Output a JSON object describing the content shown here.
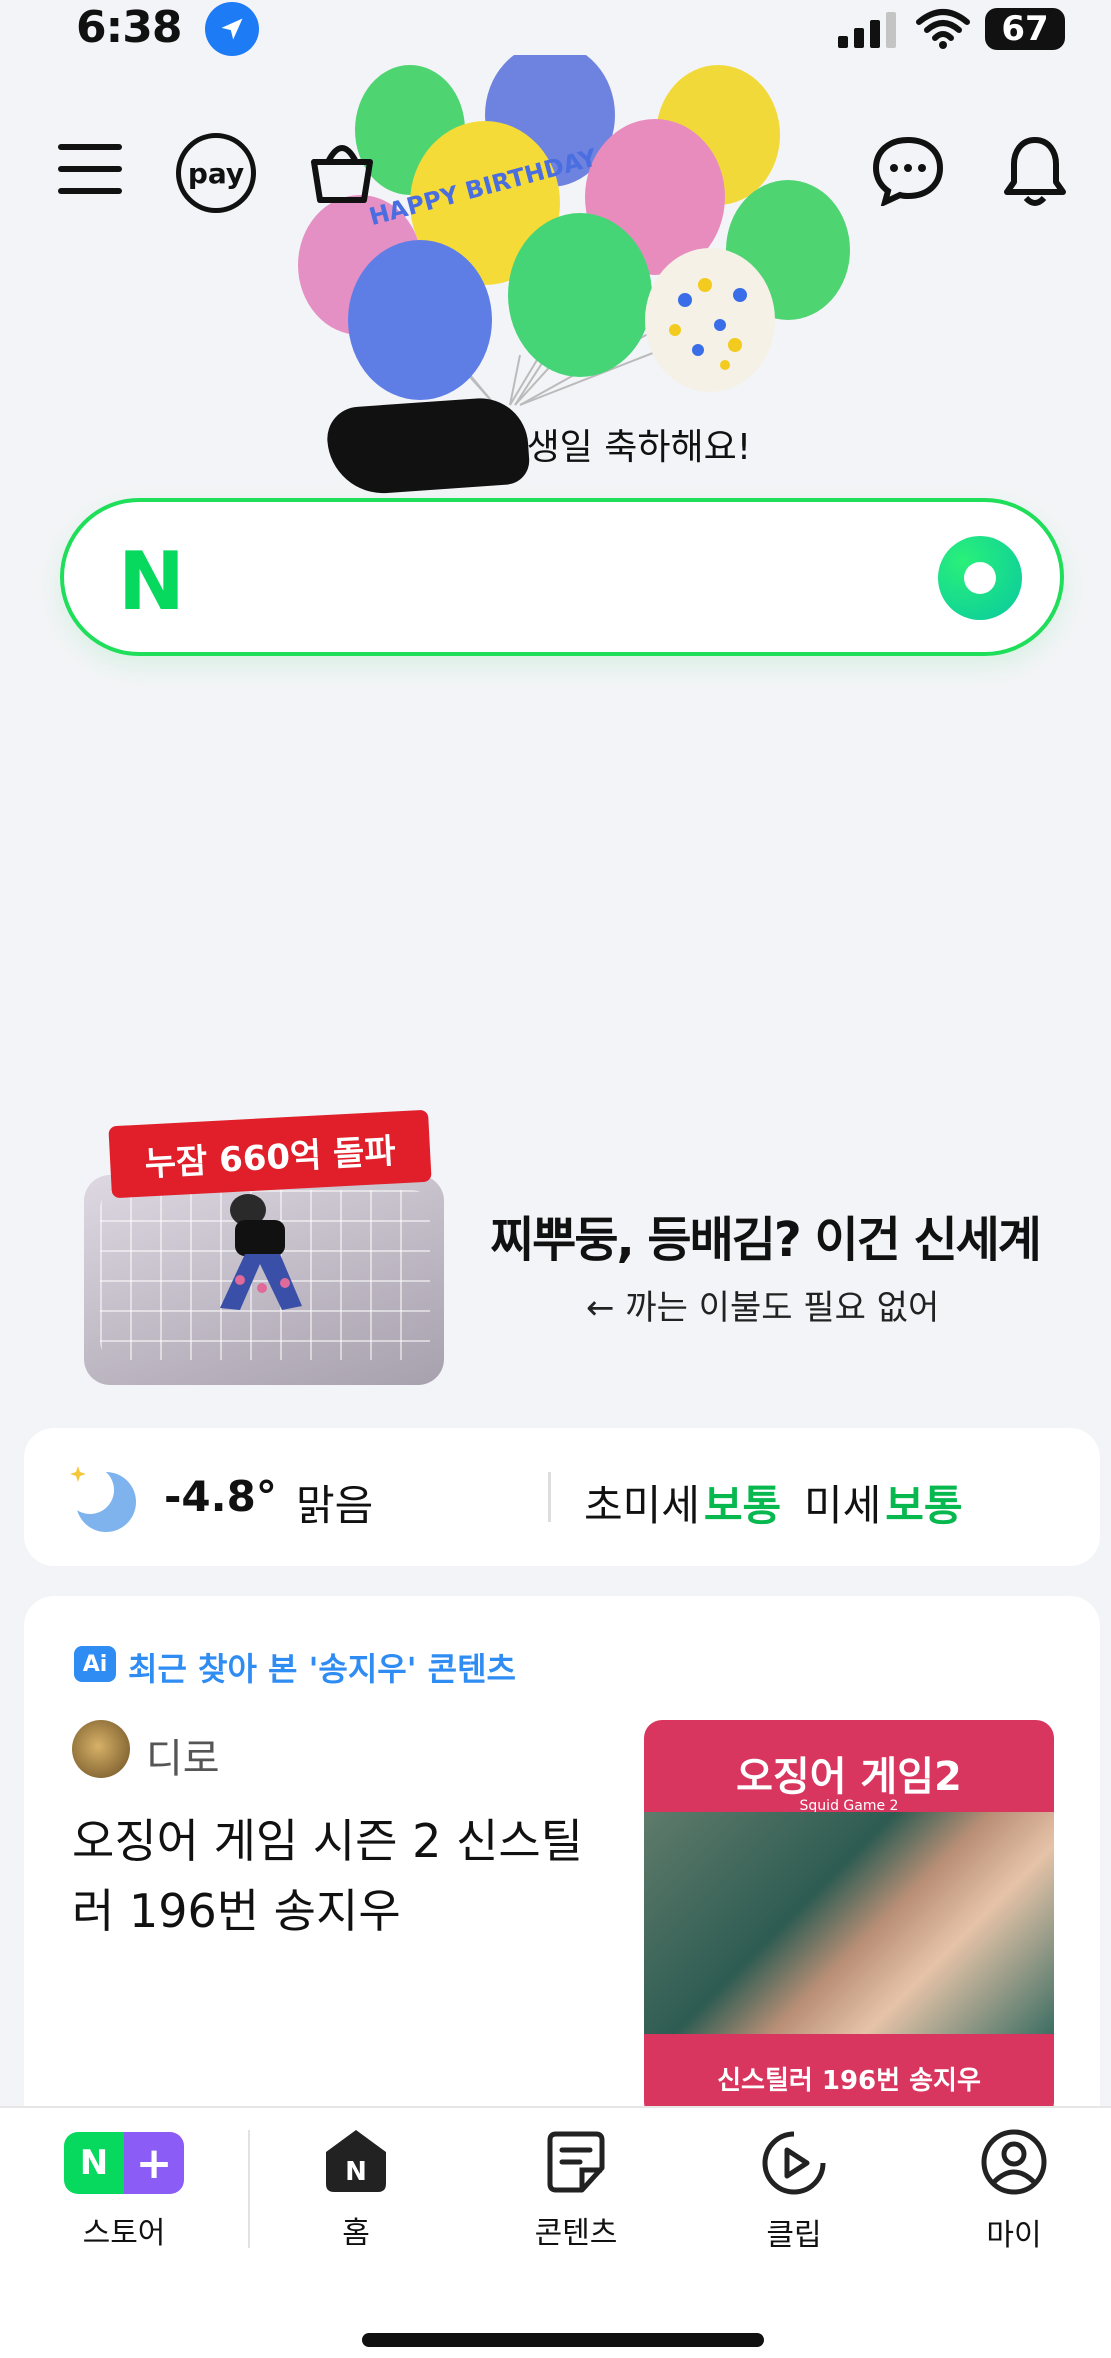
{
  "status": {
    "time": "6:38",
    "battery": "67"
  },
  "header": {
    "pay_label": "pay"
  },
  "balloons": {
    "banner_text": "HAPPY BIRTHDAY",
    "greeting": "님 생일 축하해요!"
  },
  "search": {
    "logo": "N"
  },
  "ad": {
    "ribbon": "누잠 660억 돌파",
    "headline": "찌뿌둥, 등배김? 이건 신세계",
    "sub": "← 까는 이불도 필요 없어"
  },
  "weather": {
    "temp": "-4.8°",
    "state": "맑음",
    "ultrafine_label": "초미세",
    "ultrafine_value": "보통",
    "fine_label": "미세",
    "fine_value": "보통"
  },
  "content": {
    "ai_badge": "Ai",
    "section_label": "최근 찾아 본 '송지우' 콘텐츠",
    "author": "디로",
    "title": "오징어 게임 시즌 2 신스틸러 196번 송지우",
    "thumb_logo": "오징어 게임2",
    "thumb_sub": "Squid Game 2",
    "thumb_caption": "신스틸러 196번 송지우"
  },
  "nav": {
    "store_n": "N",
    "store_plus": "+",
    "store": "스토어",
    "home": "홈",
    "home_icon_letter": "N",
    "contents": "콘텐츠",
    "clip": "클립",
    "my": "마이"
  },
  "colors": {
    "naver_green": "#06d95d",
    "good_green": "#06b84d",
    "accent_blue": "#2f8cf2",
    "thumb_pink": "#d9365f"
  }
}
